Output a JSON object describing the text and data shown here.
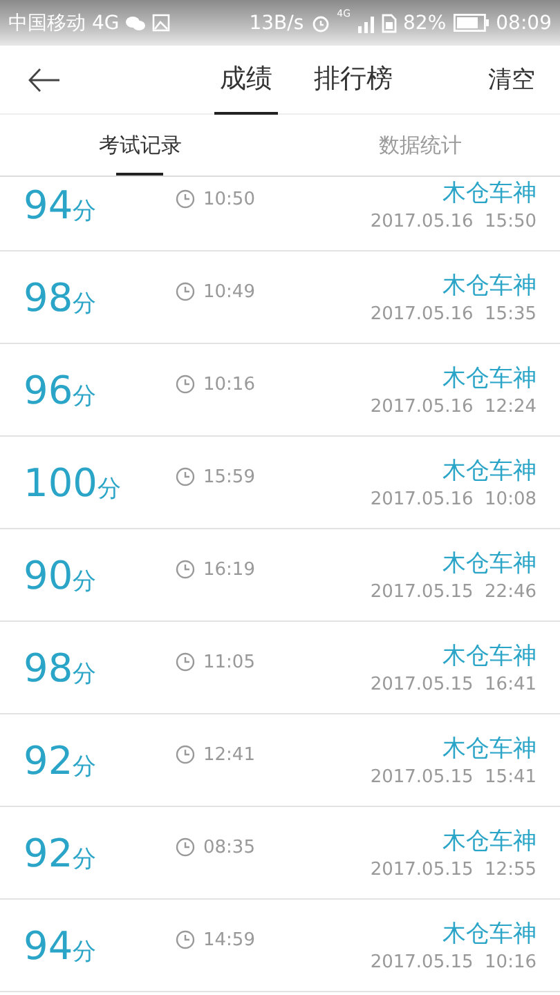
{
  "status_bar": {
    "carrier": "中国移动 4G",
    "speed": "13B/s",
    "network": "4G",
    "battery": "82%",
    "time": "08:09"
  },
  "header": {
    "tabs": [
      {
        "label": "成绩",
        "selected": true
      },
      {
        "label": "排行榜",
        "selected": false
      }
    ],
    "action": "清空"
  },
  "sub_tabs": [
    {
      "label": "考试记录",
      "selected": true
    },
    {
      "label": "数据统计",
      "selected": false
    }
  ],
  "records": [
    {
      "score": "94",
      "unit": "分",
      "duration": "10:50",
      "name": "木仓车神",
      "date": "2017.05.16  15:50"
    },
    {
      "score": "98",
      "unit": "分",
      "duration": "10:49",
      "name": "木仓车神",
      "date": "2017.05.16  15:35"
    },
    {
      "score": "96",
      "unit": "分",
      "duration": "10:16",
      "name": "木仓车神",
      "date": "2017.05.16  12:24"
    },
    {
      "score": "100",
      "unit": "分",
      "duration": "15:59",
      "name": "木仓车神",
      "date": "2017.05.16  10:08"
    },
    {
      "score": "90",
      "unit": "分",
      "duration": "16:19",
      "name": "木仓车神",
      "date": "2017.05.15  22:46"
    },
    {
      "score": "98",
      "unit": "分",
      "duration": "11:05",
      "name": "木仓车神",
      "date": "2017.05.15  16:41"
    },
    {
      "score": "92",
      "unit": "分",
      "duration": "12:41",
      "name": "木仓车神",
      "date": "2017.05.15  15:41"
    },
    {
      "score": "92",
      "unit": "分",
      "duration": "08:35",
      "name": "木仓车神",
      "date": "2017.05.15  12:55"
    },
    {
      "score": "94",
      "unit": "分",
      "duration": "14:59",
      "name": "木仓车神",
      "date": "2017.05.15  10:16"
    }
  ]
}
